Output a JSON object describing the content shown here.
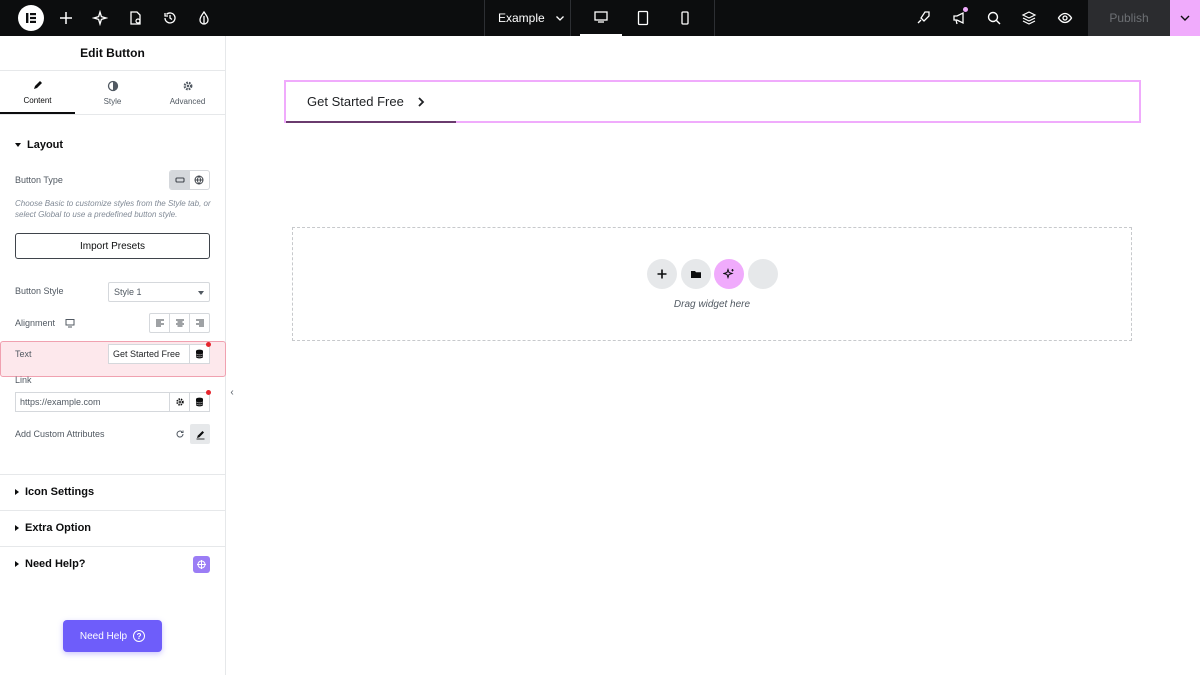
{
  "topbar": {
    "site_name": "Example",
    "publish_label": "Publish"
  },
  "panel": {
    "title": "Edit Button",
    "tabs": [
      {
        "label": "Content",
        "icon": "pencil-icon"
      },
      {
        "label": "Style",
        "icon": "half-circle-icon"
      },
      {
        "label": "Advanced",
        "icon": "gear-icon"
      }
    ],
    "layout": {
      "title": "Layout",
      "button_type_label": "Button Type",
      "hint": "Choose Basic to customize styles from the Style tab, or select Global to use a predefined button style.",
      "import_presets_label": "Import Presets",
      "button_style_label": "Button Style",
      "button_style_value": "Style 1",
      "alignment_label": "Alignment",
      "text_label": "Text",
      "text_value": "Get Started Free",
      "link_label": "Link",
      "link_value": "https://example.com",
      "custom_attr_label": "Add Custom Attributes"
    },
    "sections": {
      "icon_settings": "Icon Settings",
      "extra_option": "Extra Option",
      "need_help": "Need Help?"
    },
    "need_help_button": "Need Help"
  },
  "canvas": {
    "button_text": "Get Started Free",
    "drop_text": "Drag widget here"
  },
  "colors": {
    "accent_pink": "#f0abfc",
    "help_purple": "#6e5dfa",
    "topbar_bg": "#0c0d0e"
  }
}
